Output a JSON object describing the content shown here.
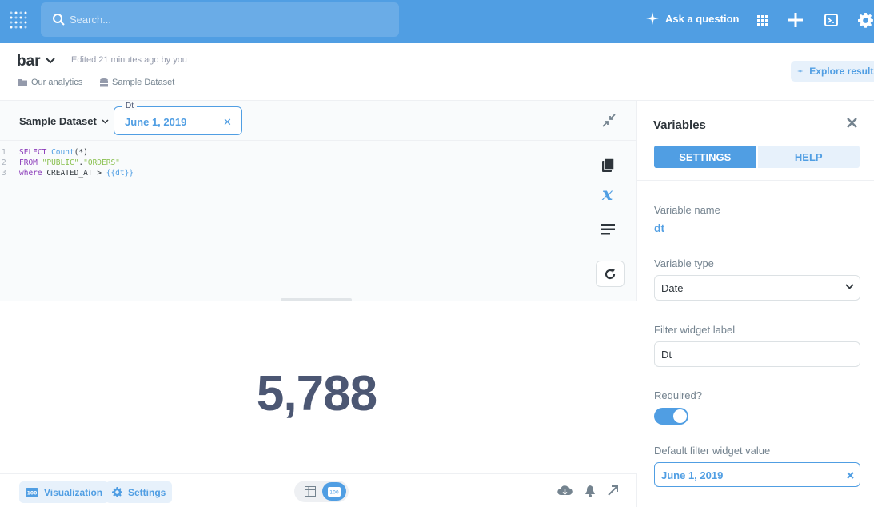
{
  "topbar": {
    "search_placeholder": "Search...",
    "ask_label": "Ask a question",
    "icons": [
      "metabase-logo-icon",
      "search-icon",
      "sparkle-icon",
      "grid-icon",
      "plus-icon",
      "terminal-icon",
      "gear-icon"
    ]
  },
  "question": {
    "title": "bar",
    "edited": "Edited 21 minutes ago by you",
    "collection": "Our analytics",
    "dataset": "Sample Dataset",
    "explore_label": "Explore results"
  },
  "editor": {
    "database": "Sample Dataset",
    "filter_label": "Dt",
    "filter_value": "June 1, 2019",
    "line_numbers": [
      "1",
      "2",
      "3"
    ],
    "code": {
      "l1_kw": "SELECT",
      "l1_fn": "Count",
      "l1_rest": "(*)",
      "l2_kw": "FROM",
      "l2_str1": "\"PUBLIC\"",
      "l2_dot": ".",
      "l2_str2": "\"ORDERS\"",
      "l3_kw": "where",
      "l3_rest": " CREATED_AT > ",
      "l3_var": "{{dt}}"
    }
  },
  "result": {
    "value": "5,788"
  },
  "footer": {
    "viz_label": "Visualization",
    "settings_label": "Settings"
  },
  "sidebar": {
    "title": "Variables",
    "tab_settings": "SETTINGS",
    "tab_help": "HELP",
    "var_name_label": "Variable name",
    "var_name": "dt",
    "var_type_label": "Variable type",
    "var_type": "Date",
    "widget_label_label": "Filter widget label",
    "widget_label": "Dt",
    "required_label": "Required?",
    "required": true,
    "default_label": "Default filter widget value",
    "default_value": "June 1, 2019"
  },
  "colors": {
    "brand": "#509ee3",
    "text_dark": "#2e353b",
    "text_medium": "#74838f",
    "number": "#4c5773"
  }
}
